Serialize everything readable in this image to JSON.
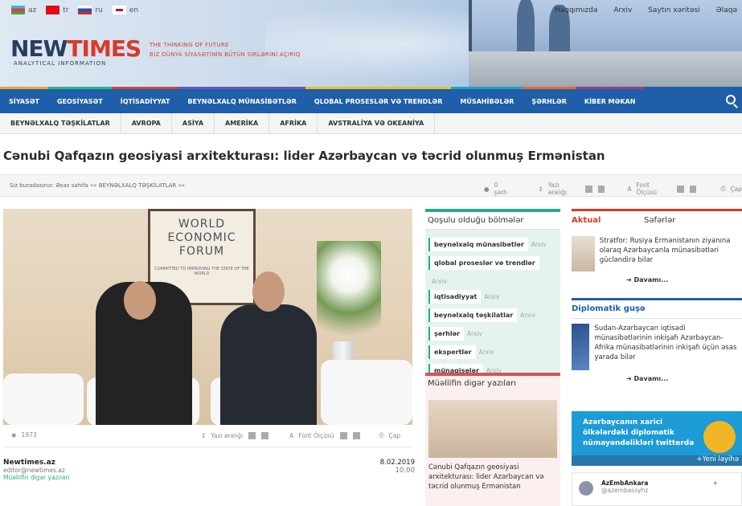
{
  "languages": [
    {
      "code": "az"
    },
    {
      "code": "tr"
    },
    {
      "code": "ru"
    },
    {
      "code": "en"
    }
  ],
  "toplinks": [
    "Haqqımızda",
    "Arxiv",
    "Saytın xəritəsi",
    "Əlaqə"
  ],
  "logo": {
    "part1": "NEW",
    "part2": "TIMES",
    "subtitle": "ANALYTICAL INFORMATION"
  },
  "tagline": {
    "line1": "THE THINKING OF FUTURE",
    "line2": "BİZ DÜNYA SİYASƏTİNİN BÜTÜN SİRLƏRİNİ AÇIRIQ"
  },
  "nav_main": [
    "SİYASƏT",
    "GEOSİYASƏT",
    "İQTİSADİYYAT",
    "BEYNƏLXALQ MÜNASİBƏTLƏR",
    "QLOBAL PROSESLƏR VƏ TRENDLƏR",
    "MÜSAHİBƏLƏR",
    "ŞƏRHLƏR",
    "KİBER MƏKAN"
  ],
  "nav_main_colors": [
    "#e9a62d",
    "#2fb487",
    "#d14a3a",
    "#6b55b3",
    "#e8c21c",
    "#1aa6c2",
    "#e2702c",
    "#9b3d88"
  ],
  "nav_sub": [
    "BEYNƏLXALQ TƏŞKİLATLAR",
    "AVROPA",
    "ASİYA",
    "AMERİKA",
    "AFRİKA",
    "AVSTRALİYA VƏ OKEANİYA"
  ],
  "article": {
    "title": "Cənubi Qafqazın geosiyasi arxitekturası: lider Azərbaycan və təcrid olunmuş Ermənistan",
    "breadcrumb": "Siz buradasınız: Əsas səhifə »» BEYNƏLXALQ TƏŞKİLATLAR »»",
    "comments": "0 şərh",
    "spacing_label": "Yazı aralığı",
    "font_label": "Font Ölçüsü",
    "print_label": "Çap",
    "views": "1973",
    "source": "Newtimes.az",
    "email": "editor@newtimes.az",
    "author_link": "Müəllifin digər yazıları",
    "date": "8.02.2019",
    "time": "10:00"
  },
  "photo": {
    "forum_line1": "WORLD",
    "forum_line2": "ECONOMIC",
    "forum_line3": "FORUM",
    "forum_caption": "COMMITTED TO IMPROVING THE STATE OF THE WORLD"
  },
  "sections": {
    "title": "Qoşulu olduğu bölmələr",
    "arch_label": "Arxiv",
    "items": [
      "beynəlxalq münasibətlər",
      "qlobal proseslər və trendlər",
      "iqtisadiyyat",
      "beynəlxalq təşkilatlar",
      "şərhlər",
      "ekspertlər",
      "münaqişələr"
    ]
  },
  "other": {
    "title": "Müəllifin digər yazıları",
    "item": "Cənubi Qafqazın geosiyasi arxitekturası: lider Azərbaycan və təcrid olunmuş Ermənistan"
  },
  "right": {
    "tab_active": "Aktual",
    "tab2": "Səfərlər",
    "news1": "Stratfor: Rusiya Ermənistanın ziyanına olaraq Azərbaycanla münasibətləri gücləndirə bilər",
    "more": "Davamı...",
    "dip_title": "Diplomatik guşə",
    "news2": "Sudan-Azərbaycan iqtisadi münasibətlərinin inkişafı Azərbaycan-Afrika münasibətlərinin inkişafı üçün əsas yarada bilər",
    "twitter_banner": "Azərbaycanın xarici ölkələrdəki diplomatik nümayəndəlikləri twitterdə",
    "twitter_more": "+Yeni layihə",
    "tw_name": "AzEmbAnkara",
    "tw_handle": "@azembassyhz"
  }
}
